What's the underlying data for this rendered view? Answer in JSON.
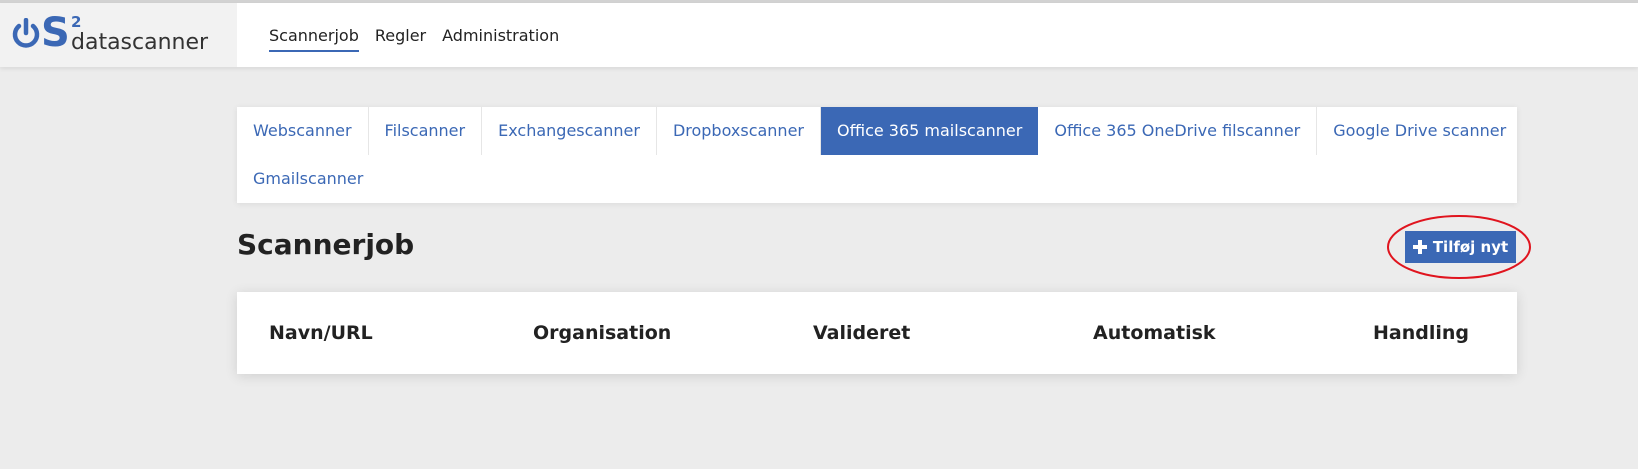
{
  "header": {
    "logo": {
      "mark": "S",
      "superscript": "2",
      "name": "datascanner",
      "icon": "power-icon"
    },
    "nav": [
      {
        "label": "Scannerjob",
        "active": true
      },
      {
        "label": "Regler",
        "active": false
      },
      {
        "label": "Administration",
        "active": false
      }
    ]
  },
  "scanner_tabs": [
    {
      "label": "Webscanner",
      "active": false
    },
    {
      "label": "Filscanner",
      "active": false
    },
    {
      "label": "Exchangescanner",
      "active": false
    },
    {
      "label": "Dropboxscanner",
      "active": false
    },
    {
      "label": "Office 365 mailscanner",
      "active": true
    },
    {
      "label": "Office 365 OneDrive filscanner",
      "active": false
    },
    {
      "label": "Google Drive scanner",
      "active": false
    },
    {
      "label": "Gmailscanner",
      "active": false
    }
  ],
  "main": {
    "title": "Scannerjob",
    "add_button": {
      "label": "Tilføj nyt",
      "icon": "plus-icon"
    },
    "table": {
      "columns": [
        "Navn/URL",
        "Organisation",
        "Valideret",
        "Automatisk",
        "Handling"
      ]
    }
  },
  "colors": {
    "accent": "#3b68b5",
    "background": "#ececec",
    "highlight_ring": "#e0141e"
  }
}
